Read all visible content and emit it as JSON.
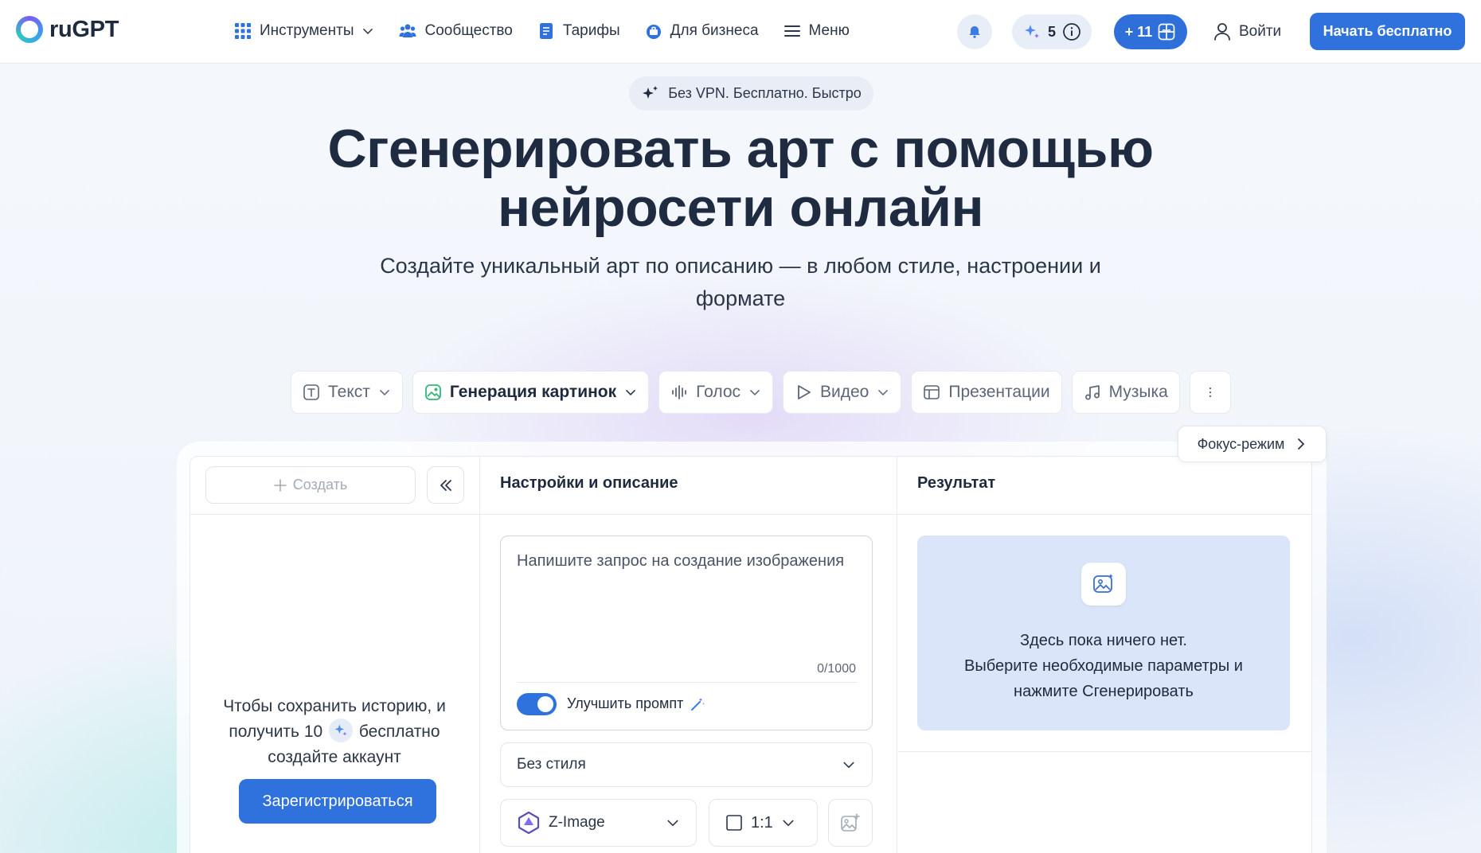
{
  "brand": {
    "name": "ruGPT"
  },
  "nav": {
    "items": [
      {
        "label": "Инструменты",
        "icon": "grid-icon",
        "dropdown": true
      },
      {
        "label": "Сообщество",
        "icon": "community-icon"
      },
      {
        "label": "Тарифы",
        "icon": "pricing-icon"
      },
      {
        "label": "Для бизнеса",
        "icon": "business-icon"
      },
      {
        "label": "Меню",
        "icon": "hamburger-icon"
      }
    ]
  },
  "header": {
    "credits": "5",
    "bonus": "+ 11",
    "login": "Войти",
    "start": "Начать бесплатно"
  },
  "hero": {
    "badge": "Без VPN. Бесплатно. Быстро",
    "title_line1": "Сгенерировать арт с помощью",
    "title_line2": "нейросети онлайн",
    "subtitle_line1": "Создайте уникальный арт по описанию — в любом стиле, настроении и",
    "subtitle_line2": "формате"
  },
  "tabs": [
    {
      "label": "Текст",
      "icon": "text-icon",
      "dropdown": true,
      "active": false
    },
    {
      "label": "Генерация картинок",
      "icon": "image-gen-icon",
      "dropdown": true,
      "active": true
    },
    {
      "label": "Голос",
      "icon": "voice-icon",
      "dropdown": true,
      "active": false
    },
    {
      "label": "Видео",
      "icon": "video-icon",
      "dropdown": true,
      "active": false
    },
    {
      "label": "Презентации",
      "icon": "presentation-icon",
      "dropdown": false,
      "active": false
    },
    {
      "label": "Музыка",
      "icon": "music-icon",
      "dropdown": false,
      "active": false
    }
  ],
  "focus_mode": "Фокус-режим",
  "sidebar": {
    "create": "Создать",
    "note_before": "Чтобы сохранить историю, и получить 10",
    "note_after": "бесплатно создайте аккаунт",
    "register": "Зарегистрироваться"
  },
  "settings": {
    "title": "Настройки и описание",
    "prompt_placeholder": "Напишите запрос на создание изображения",
    "counter": "0/1000",
    "improve_prompt": "Улучшить промпт",
    "improve_enabled": true,
    "style": "Без стиля",
    "model": "Z-Image",
    "ratio": "1:1"
  },
  "result": {
    "title": "Результат",
    "empty_line1": "Здесь пока ничего нет.",
    "empty_line2": "Выберите необходимые параметры и",
    "empty_line3": "нажмите Сгенерировать"
  },
  "colors": {
    "accent": "#2f72de",
    "result_bg": "#dbe5f9"
  }
}
